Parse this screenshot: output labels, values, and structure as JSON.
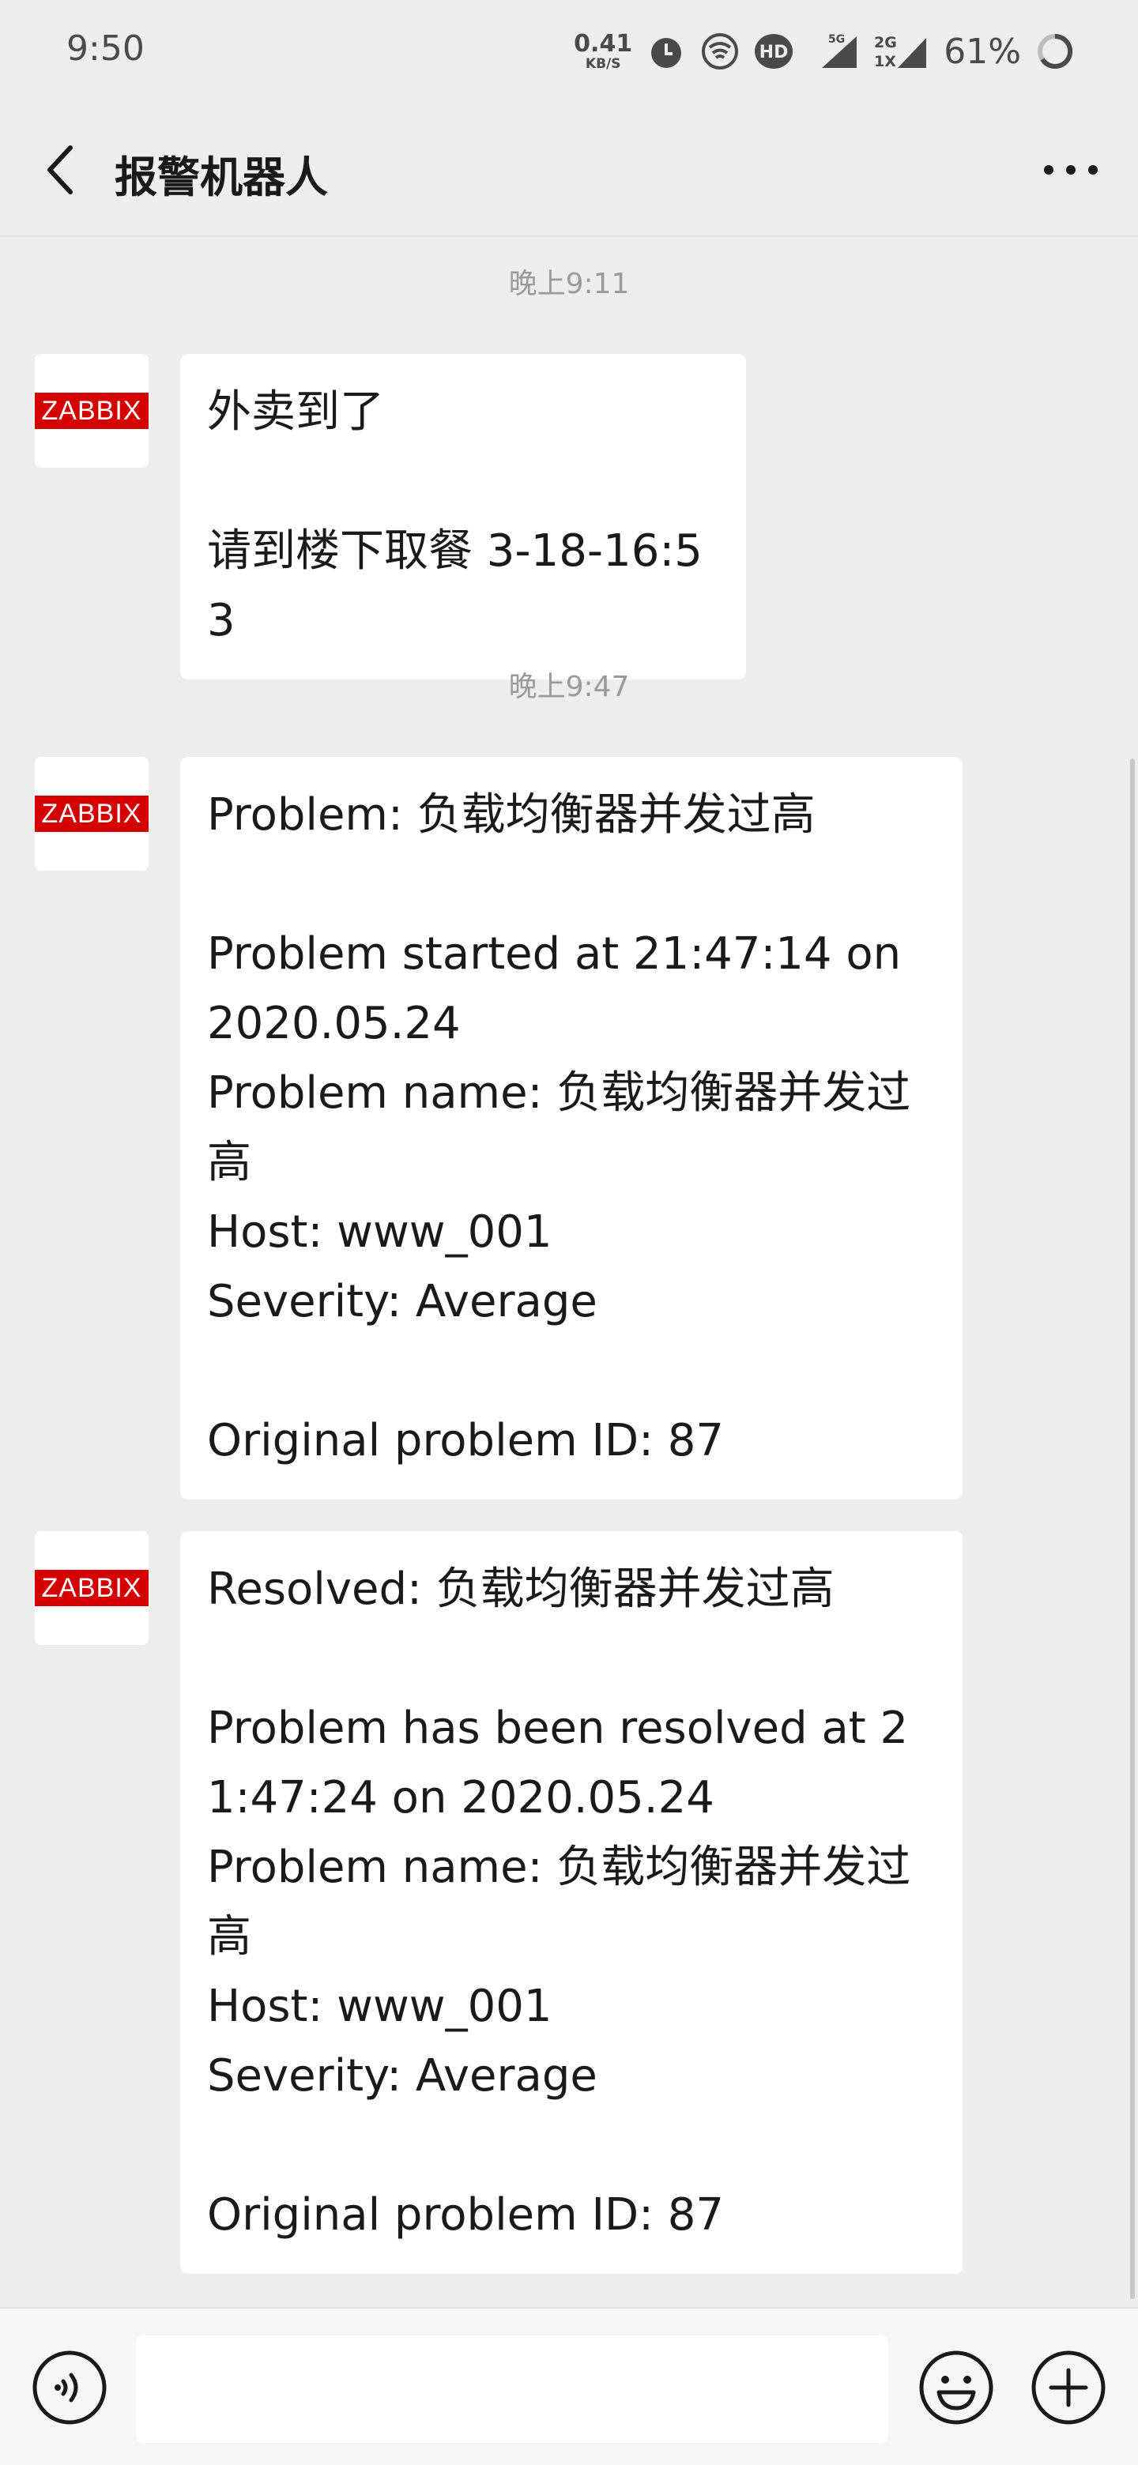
{
  "status_bar": {
    "time": "9:50",
    "net_speed_value": "0.41",
    "net_speed_unit": "KB/S",
    "network_5g": "5G",
    "network_2g": "2G",
    "network_1x": "1X",
    "hd_badge": "HD",
    "battery_percent": "61%"
  },
  "header": {
    "title": "报警机器人"
  },
  "messages": [
    {
      "timestamp": "晚上9:11",
      "sender_logo": "ZABBIX",
      "text": "外卖到了\n\n请到楼下取餐 3-18-16:53"
    },
    {
      "timestamp": "晚上9:47",
      "sender_logo": "ZABBIX",
      "text": "Problem: 负载均衡器并发过高\n\nProblem started at 21:47:14 on 2020.05.24\nProblem name: 负载均衡器并发过高\nHost: www_001\nSeverity: Average\n\nOriginal problem ID: 87"
    },
    {
      "sender_logo": "ZABBIX",
      "text": "Resolved: 负载均衡器并发过高\n\nProblem has been resolved at 21:47:24 on 2020.05.24\nProblem name: 负载均衡器并发过高\nHost: www_001\nSeverity: Average\n\nOriginal problem ID: 87"
    }
  ],
  "input_bar": {
    "value": "",
    "placeholder": ""
  },
  "icons": {
    "back": "chevron-left-icon",
    "more": "more-dots-icon",
    "voice": "voice-icon",
    "emoji": "emoji-icon",
    "plus": "plus-icon"
  }
}
